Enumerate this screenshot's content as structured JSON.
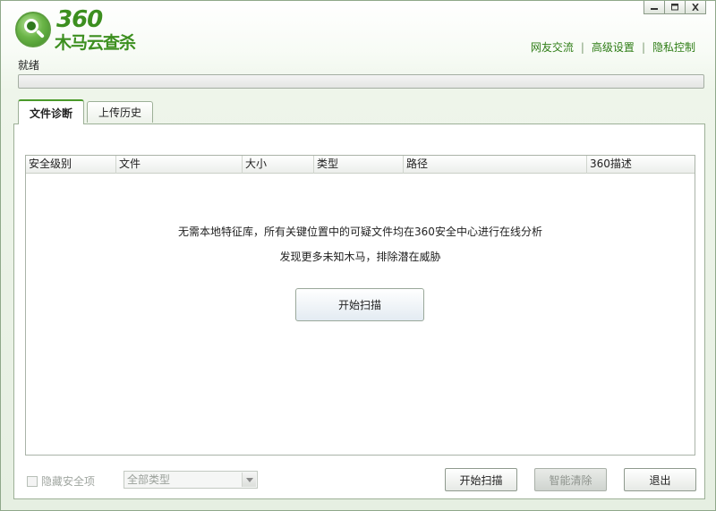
{
  "window": {
    "controls": {
      "minimize": "minimize-icon",
      "maximize": "maximize-icon",
      "close": "close-icon"
    }
  },
  "logo": {
    "number": "360",
    "text": "木马云查杀"
  },
  "header": {
    "links": [
      "网友交流",
      "高级设置",
      "隐私控制"
    ]
  },
  "status": {
    "text": "就绪",
    "progress": 0
  },
  "tabs": [
    {
      "label": "文件诊断",
      "active": true
    },
    {
      "label": "上传历史",
      "active": false
    }
  ],
  "table": {
    "columns": [
      "安全级别",
      "文件",
      "大小",
      "类型",
      "路径",
      "360描述"
    ],
    "rows": []
  },
  "empty_state": {
    "line1": "无需本地特征库，所有关键位置中的可疑文件均在360安全中心进行在线分析",
    "line2": "发现更多未知木马，排除潜在威胁",
    "button": "开始扫描"
  },
  "footer": {
    "checkbox_label": "隐藏安全项",
    "select_value": "全部类型",
    "buttons": {
      "scan": "开始扫描",
      "clean": "智能清除",
      "exit": "退出"
    }
  },
  "colors": {
    "accent": "#3c8f1f",
    "link": "#2e7d16",
    "border": "#9db097"
  }
}
